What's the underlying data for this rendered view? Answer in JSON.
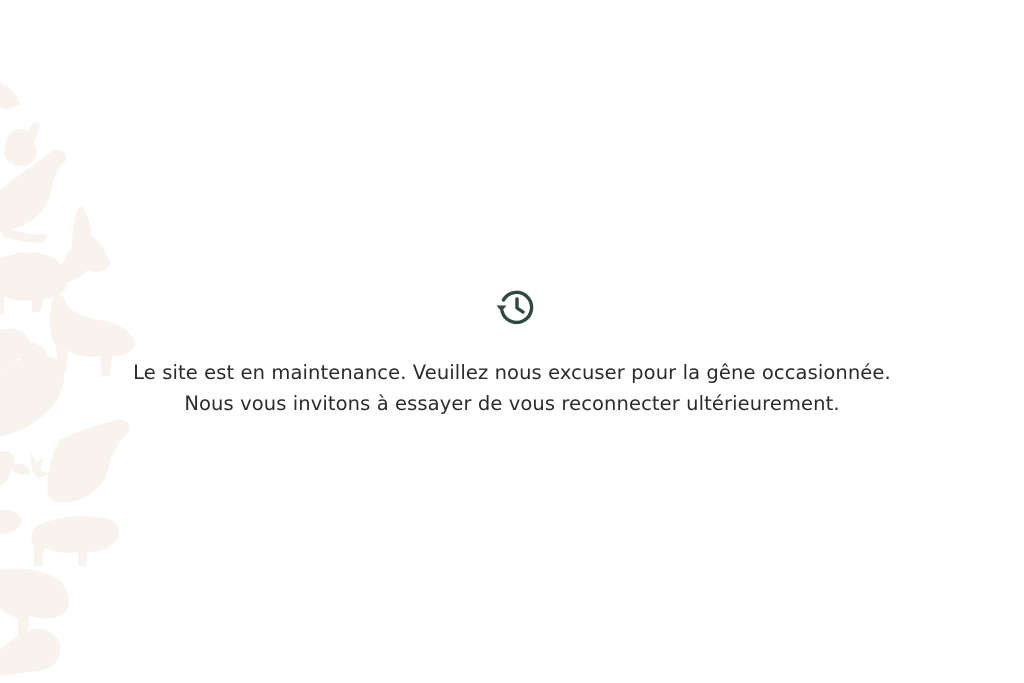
{
  "maintenance": {
    "icon": "history-icon",
    "line1": "Le site est en maintenance. Veuillez nous excuser pour la gêne occasionnée.",
    "line2": "Nous vous invitons à essayer de vous reconnecter ultérieurement."
  },
  "colors": {
    "background": "#ffffff",
    "text": "#2b2b2b",
    "icon": "#2f4a3c",
    "decor": "#f8f3ed"
  }
}
